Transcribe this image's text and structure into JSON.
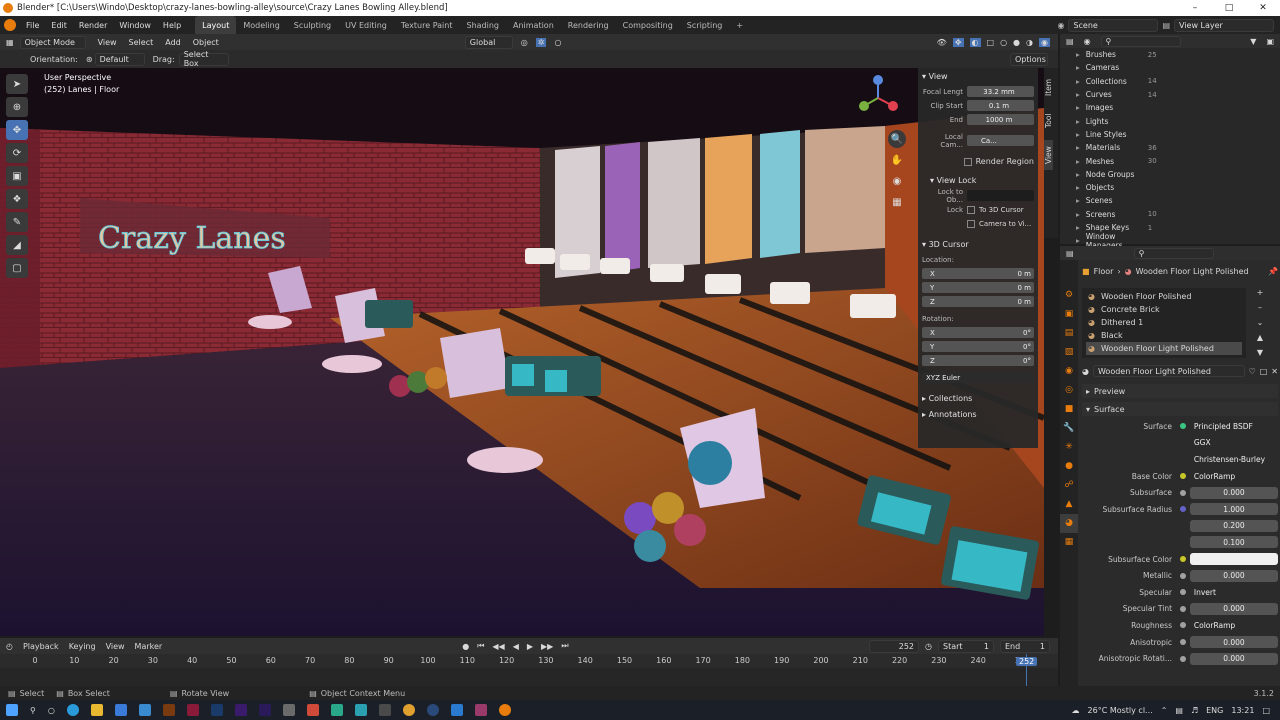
{
  "window": {
    "title": "Blender* [C:\\Users\\Windo\\Desktop\\crazy-lanes-bowling-alley\\source\\Crazy Lanes Bowling Alley.blend]"
  },
  "menu": [
    "File",
    "Edit",
    "Render",
    "Window",
    "Help"
  ],
  "workspaces": [
    "Layout",
    "Modeling",
    "Sculpting",
    "UV Editing",
    "Texture Paint",
    "Shading",
    "Animation",
    "Rendering",
    "Compositing",
    "Scripting"
  ],
  "scene": "Scene",
  "view_layer": "View Layer",
  "viewport_header": {
    "mode": "Object Mode",
    "menus": [
      "View",
      "Select",
      "Add",
      "Object"
    ],
    "transform": "Global"
  },
  "tool_header": {
    "orientation_label": "Orientation:",
    "orientation": "Default",
    "drag_label": "Drag:",
    "drag": "Select Box",
    "options": "Options"
  },
  "viewport_overlay": {
    "perspective": "User Perspective",
    "object": "(252) Lanes | Floor"
  },
  "scene_text": {
    "sign": "Crazy Lanes"
  },
  "npanel": {
    "tabs": [
      "Item",
      "Tool",
      "View"
    ],
    "view": {
      "header": "View",
      "focal_label": "Focal Lengt",
      "focal": "33.2 mm",
      "clip_start_label": "Clip Start",
      "clip_start": "0.1 m",
      "end_label": "End",
      "end": "1000 m",
      "local_cam_label": "Local Cam...",
      "local_cam": "Ca...",
      "render_region": "Render Region"
    },
    "view_lock": {
      "header": "View Lock",
      "lock_to_obj_label": "Lock to Ob...",
      "lock_label": "Lock",
      "to_3d_cursor": "To 3D Cursor",
      "camera_to_view": "Camera to Vi..."
    },
    "cursor": {
      "header": "3D Cursor",
      "location_label": "Location:",
      "x": "0 m",
      "y": "0 m",
      "z": "0 m",
      "rotation_label": "Rotation:",
      "rx": "0°",
      "ry": "0°",
      "rz": "0°",
      "mode": "XYZ Euler"
    },
    "collections": "Collections",
    "annotations": "Annotations"
  },
  "outliner": {
    "items": [
      {
        "label": "Brushes",
        "count": "25"
      },
      {
        "label": "Cameras",
        "count": ""
      },
      {
        "label": "Collections",
        "count": "14"
      },
      {
        "label": "Curves",
        "count": "14"
      },
      {
        "label": "Images",
        "count": ""
      },
      {
        "label": "Lights",
        "count": ""
      },
      {
        "label": "Line Styles",
        "count": ""
      },
      {
        "label": "Materials",
        "count": "36"
      },
      {
        "label": "Meshes",
        "count": "30"
      },
      {
        "label": "Node Groups",
        "count": ""
      },
      {
        "label": "Objects",
        "count": ""
      },
      {
        "label": "Scenes",
        "count": ""
      },
      {
        "label": "Screens",
        "count": "10"
      },
      {
        "label": "Shape Keys",
        "count": "1"
      },
      {
        "label": "Window Managers",
        "count": ""
      }
    ]
  },
  "properties": {
    "breadcrumb": {
      "object": "Floor",
      "material": "Wooden Floor Light Polished"
    },
    "materials": [
      "Wooden Floor Polished",
      "Concrete Brick",
      "Dithered 1",
      "Black",
      "Wooden Floor Light Polished"
    ],
    "active_material": "Wooden Floor Light Polished",
    "preview": "Preview",
    "surface": "Surface",
    "rows": [
      {
        "label": "Surface",
        "value": "Principled BSDF",
        "dot": "#39c884"
      },
      {
        "label": "",
        "value": "GGX",
        "dot": ""
      },
      {
        "label": "",
        "value": "Christensen-Burley",
        "dot": ""
      },
      {
        "label": "Base Color",
        "value": "ColorRamp",
        "dot": "#c7c729"
      },
      {
        "label": "Subsurface",
        "value": "0.000",
        "dot": "#a1a1a1"
      },
      {
        "label": "Subsurface Radius",
        "value": "1.000",
        "dot": "#6363c7"
      },
      {
        "label": "",
        "value": "0.200",
        "dot": ""
      },
      {
        "label": "",
        "value": "0.100",
        "dot": ""
      },
      {
        "label": "Subsurface Color",
        "value": "",
        "dot": "#c7c729"
      },
      {
        "label": "Metallic",
        "value": "0.000",
        "dot": "#a1a1a1"
      },
      {
        "label": "Specular",
        "value": "Invert",
        "dot": "#a1a1a1"
      },
      {
        "label": "Specular Tint",
        "value": "0.000",
        "dot": "#a1a1a1"
      },
      {
        "label": "Roughness",
        "value": "ColorRamp",
        "dot": "#a1a1a1"
      },
      {
        "label": "Anisotropic",
        "value": "0.000",
        "dot": "#a1a1a1"
      },
      {
        "label": "Anisotropic Rotati...",
        "value": "0.000",
        "dot": "#a1a1a1"
      }
    ]
  },
  "timeline": {
    "menus": [
      "Playback",
      "Keying",
      "View",
      "Marker"
    ],
    "current_frame": "252",
    "start_label": "Start",
    "start": "1",
    "end_label": "End",
    "end": "1",
    "ticks": [
      "0",
      "10",
      "20",
      "30",
      "40",
      "50",
      "60",
      "70",
      "80",
      "90",
      "100",
      "110",
      "120",
      "130",
      "140",
      "150",
      "160",
      "170",
      "180",
      "190",
      "200",
      "210",
      "220",
      "230",
      "240",
      "2"
    ],
    "playhead": "252"
  },
  "statusbar": {
    "select": "Select",
    "box_select": "Box Select",
    "rotate": "Rotate View",
    "context": "Object Context Menu",
    "version": "3.1.2"
  },
  "taskbar": {
    "weather": "26°C  Mostly cl...",
    "lang": "ENG",
    "time": "13:21"
  },
  "colors": {
    "accent": "#4772b3",
    "active_tab": "#3d3d3d",
    "bg": "#1d1d1d"
  }
}
